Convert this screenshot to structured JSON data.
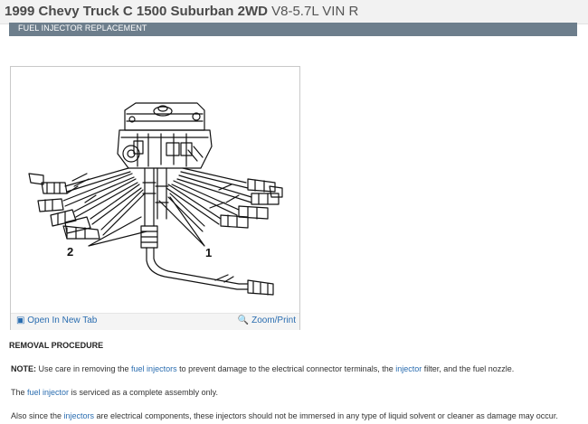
{
  "header": {
    "vehicle": "1999 Chevy Truck C 1500 Suburban 2WD",
    "engine": "V8-5.7L VIN R"
  },
  "section": {
    "title": "FUEL INJECTOR REPLACEMENT"
  },
  "figure": {
    "callout_1": "1",
    "callout_2": "2",
    "open_new_tab": "Open In New Tab",
    "zoom_print": "Zoom/Print",
    "open_icon": "open-in-new-tab-icon",
    "zoom_icon": "magnifier-icon"
  },
  "procedure": {
    "heading": "REMOVAL PROCEDURE",
    "para1": {
      "note_label": "NOTE:",
      "t1": " Use care in removing the ",
      "l1": "fuel injectors",
      "t2": " to prevent damage to the electrical connector terminals, the ",
      "l2": "injector",
      "t3": " filter, and the fuel nozzle."
    },
    "para2": {
      "t1": "The ",
      "l1": "fuel injector",
      "t2": " is serviced as a complete assembly only."
    },
    "para3": {
      "t1": "Also since the ",
      "l1": "injectors",
      "t2": " are electrical components, these injectors should not be immersed in any type of liquid solvent or cleaner as damage may occur."
    }
  },
  "colors": {
    "section_bar": "#6d7e8c",
    "link": "#2a6db0",
    "header_bg": "#f2f2f2"
  }
}
